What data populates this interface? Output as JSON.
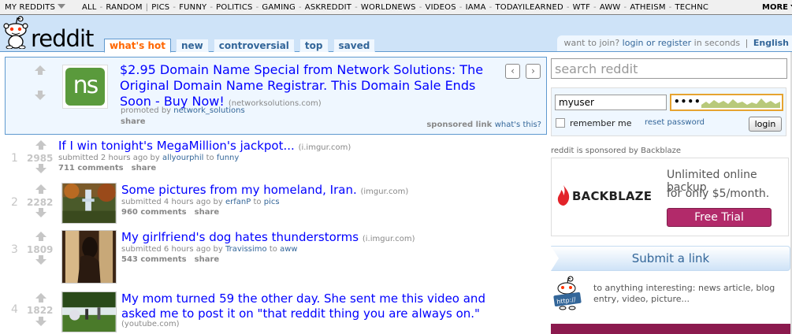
{
  "topbar": {
    "my_subreddits": "MY REDDITS",
    "subreddits": [
      "ALL",
      "RANDOM",
      "PICS",
      "FUNNY",
      "POLITICS",
      "GAMING",
      "ASKREDDIT",
      "WORLDNEWS",
      "VIDEOS",
      "IAMA",
      "TODAYILEARNED",
      "WTF",
      "AWW",
      "ATHEISM",
      "TECHNC"
    ],
    "more": "MORE"
  },
  "header": {
    "logo_text": "reddit",
    "tabs": [
      "what's hot",
      "new",
      "controversial",
      "top",
      "saved"
    ],
    "want_to_join": "want to join?",
    "login_register": "login or register",
    "in_seconds": "in seconds",
    "language": "English"
  },
  "promoted": {
    "thumb_text": "ns",
    "title": "$2.95 Domain Name Special from Network Solutions: The Original Domain Name Registrar. This Domain Sale Ends Soon - Buy Now!",
    "domain": "(networksolutions.com)",
    "promoted_by": "promoted by",
    "promoter": "network_solutions",
    "share": "share",
    "sponsored_link": "sponsored link",
    "whats_this": "what's this?",
    "prev": "‹",
    "next": "›"
  },
  "links": [
    {
      "rank": "1",
      "score": "2985",
      "title": "If I win tonight's MegaMillion's jackpot...",
      "domain": "(i.imgur.com)",
      "age": "submitted 2 hours ago by",
      "author": "allyourphil",
      "to": "to",
      "subreddit": "funny",
      "comments": "711 comments",
      "share": "share"
    },
    {
      "rank": "2",
      "score": "2282",
      "title": "Some pictures from my homeland, Iran.",
      "domain": "(imgur.com)",
      "age": "submitted 4 hours ago by",
      "author": "erfanP",
      "to": "to",
      "subreddit": "pics",
      "comments": "960 comments",
      "share": "share"
    },
    {
      "rank": "3",
      "score": "1809",
      "title": "My girlfriend's dog hates thunderstorms",
      "domain": "(i.imgur.com)",
      "age": "submitted 6 hours ago by",
      "author": "Travissimo",
      "to": "to",
      "subreddit": "aww",
      "comments": "543 comments",
      "share": "share"
    },
    {
      "rank": "4",
      "score": "1822",
      "title_line1": "My mom turned 59 the other day. She sent me this video and",
      "title_line2": "asked me to post it on \"that reddit thing you are always on.\"",
      "domain": "(youtube.com)"
    }
  ],
  "sidebar": {
    "search_placeholder": "search reddit",
    "username_value": "myuser",
    "password_value": "••••",
    "remember_me": "remember me",
    "reset_password": "reset password",
    "login_button": "login",
    "sponsored_by": "reddit is sponsored by Backblaze",
    "ad_brand": "BACKBLAZE",
    "ad_line1": "Unlimited online backup",
    "ad_line2": "for only $5/month.",
    "ad_cta": "Free Trial",
    "submit_link": "Submit a link",
    "submit_desc": "to anything interesting: news article, blog entry, video, picture...",
    "submit_icon_text": "http://"
  },
  "colors": {
    "header_bg": "#cee3f8",
    "link_blue": "#0000ff",
    "accent_orange": "#ff6600",
    "meta_blue": "#336699",
    "trial_button": "#b22a6a"
  }
}
